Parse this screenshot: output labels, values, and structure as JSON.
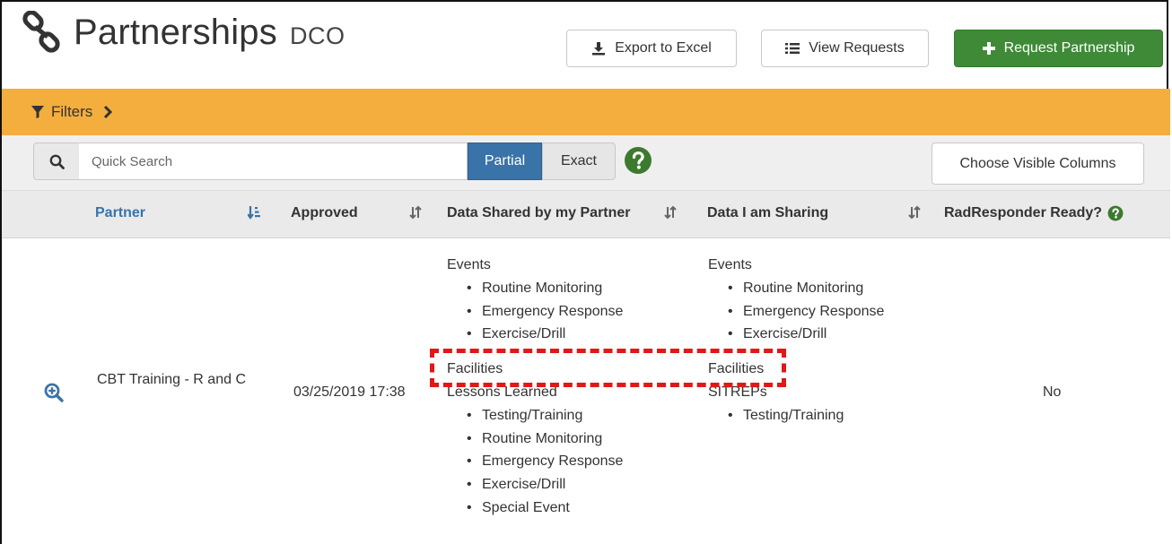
{
  "header": {
    "title": "Partnerships",
    "subtitle": "DCO",
    "export_label": "Export to Excel",
    "view_requests_label": "View Requests",
    "request_label": "Request Partnership"
  },
  "filters": {
    "label": "Filters"
  },
  "search": {
    "placeholder": "Quick Search",
    "value": "",
    "partial_label": "Partial",
    "exact_label": "Exact",
    "mode_selected": "Partial",
    "choose_columns_label": "Choose Visible Columns"
  },
  "table": {
    "columns": [
      "Partner",
      "Approved",
      "Data Shared by my Partner",
      "Data I am Sharing",
      "RadResponder Ready?"
    ],
    "rows": [
      {
        "partner": "CBT Training - R and C",
        "approved": "03/25/2019 17:38",
        "shared_by_partner": [
          {
            "category": "Events",
            "items": [
              "Routine Monitoring",
              "Emergency Response",
              "Exercise/Drill"
            ]
          },
          {
            "category": "Facilities",
            "items": []
          },
          {
            "category": "Lessons Learned",
            "items": [
              "Testing/Training",
              "Routine Monitoring",
              "Emergency Response",
              "Exercise/Drill",
              "Special Event"
            ]
          }
        ],
        "i_am_sharing": [
          {
            "category": "Events",
            "items": [
              "Routine Monitoring",
              "Emergency Response",
              "Exercise/Drill"
            ]
          },
          {
            "category": "Facilities",
            "items": []
          },
          {
            "category": "SITREPs",
            "items": [
              "Testing/Training"
            ]
          }
        ],
        "radresponder_ready": "No"
      }
    ]
  },
  "colors": {
    "filter_bar": "#f4ae3d",
    "primary_green": "#3e8a37",
    "primary_blue": "#3a73a8",
    "help_green": "#3c7a2e",
    "highlight_red": "#e01818"
  },
  "icons": {
    "title": "link-icon",
    "export": "download-icon",
    "view_requests": "list-icon",
    "request": "plus-icon",
    "filters": "funnel-icon",
    "filters_toggle": "chevron-right-icon",
    "search": "search-icon",
    "help": "question-circle-icon",
    "row_expand": "zoom-in-icon"
  }
}
